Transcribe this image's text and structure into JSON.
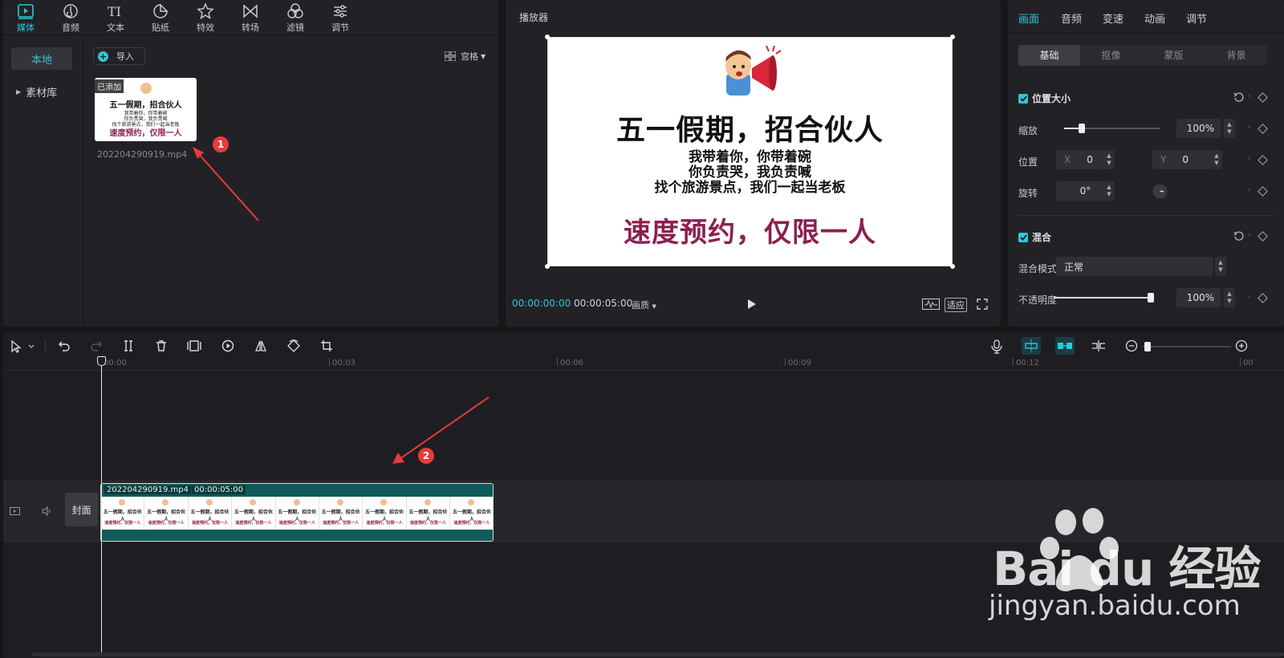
{
  "media_panel": {
    "tabs": [
      {
        "label": "媒体",
        "icon": "media-icon"
      },
      {
        "label": "音频",
        "icon": "audio-icon"
      },
      {
        "label": "文本",
        "icon": "text-icon"
      },
      {
        "label": "贴纸",
        "icon": "sticker-icon"
      },
      {
        "label": "特效",
        "icon": "effects-icon"
      },
      {
        "label": "转场",
        "icon": "transition-icon"
      },
      {
        "label": "滤镜",
        "icon": "filter-icon"
      },
      {
        "label": "调节",
        "icon": "adjust-icon"
      }
    ],
    "side_nav": {
      "local": "本地",
      "library": "素材库"
    },
    "import_label": "导入",
    "view_label": "宫格",
    "media_item": {
      "badge": "已添加",
      "filename": "202204290919.mp4"
    },
    "marker_1": "1"
  },
  "player": {
    "title": "播放器",
    "frame": {
      "title": "五一假期，招合伙人",
      "lines": [
        "我带着你，你带着碗",
        "你负责哭，我负责喊",
        "找个旅游景点，我们一起当老板"
      ],
      "highlight": "速度预约，仅限一人"
    },
    "time_current": "00:00:00:00",
    "time_total": "00:00:05:00",
    "quality_label": "画质",
    "fit_label": "适应"
  },
  "properties": {
    "tabs": [
      "画面",
      "音频",
      "变速",
      "动画",
      "调节"
    ],
    "sub_tabs": [
      "基础",
      "抠像",
      "蒙版",
      "背景"
    ],
    "position_size": {
      "heading": "位置大小",
      "scale_label": "缩放",
      "scale_value": "100%",
      "scale_fraction": 0.18,
      "position_label": "位置",
      "x_label": "X",
      "x_value": "0",
      "y_label": "Y",
      "y_value": "0",
      "rotation_label": "旋转",
      "rotation_value": "0°"
    },
    "blend": {
      "heading": "混合",
      "mode_label": "混合模式",
      "mode_value": "正常",
      "opacity_label": "不透明度",
      "opacity_value": "100%",
      "opacity_fraction": 1.0
    }
  },
  "timeline": {
    "ruler_ticks": [
      "00:00",
      "00:03",
      "00:06",
      "00:09",
      "00:12",
      "00"
    ],
    "cover_label": "封面",
    "clip": {
      "filename": "202204290919.mp4",
      "duration": "00:00:05:00"
    },
    "marker_2": "2"
  },
  "watermark": {
    "brand": "Bai du 经验",
    "url": "jingyan.baidu.com"
  },
  "colors": {
    "accent": "#2fc6d6",
    "highlight_text": "#8b2050",
    "clip_bg": "#0f5a5a",
    "marker": "#e63b3b"
  }
}
